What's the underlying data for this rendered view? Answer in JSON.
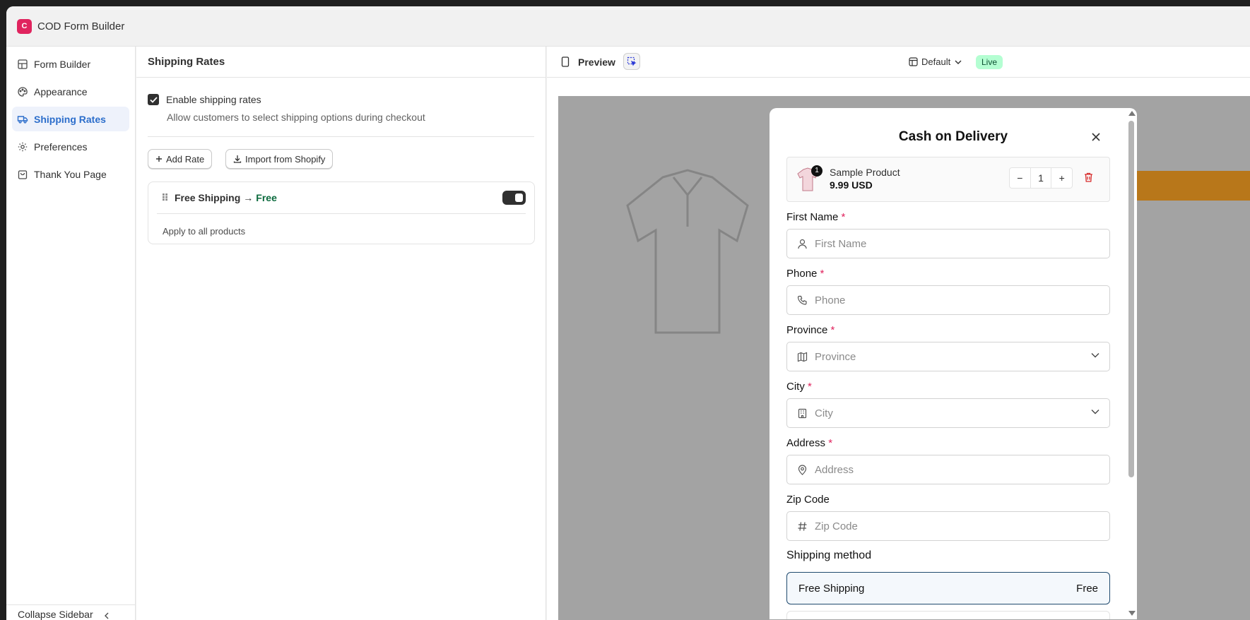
{
  "app": {
    "title": "COD Form Builder",
    "logo_text": "C"
  },
  "sidebar": {
    "items": [
      {
        "label": "Form Builder",
        "icon": "layout-icon"
      },
      {
        "label": "Appearance",
        "icon": "palette-icon"
      },
      {
        "label": "Shipping Rates",
        "icon": "truck-icon",
        "active": true
      },
      {
        "label": "Preferences",
        "icon": "gear-icon"
      },
      {
        "label": "Thank You Page",
        "icon": "bag-icon"
      }
    ],
    "collapse_label": "Collapse Sidebar"
  },
  "panel": {
    "title": "Shipping Rates",
    "enable_label": "Enable shipping rates",
    "enable_checked": true,
    "enable_help": "Allow customers to select shipping options during checkout",
    "add_rate": "Add Rate",
    "import_shopify": "Import from Shopify",
    "rate": {
      "name": "Free Shipping",
      "arrow": "→",
      "price": "Free",
      "scope": "Apply to all products",
      "enabled": true
    }
  },
  "preview": {
    "label": "Preview",
    "theme": "Default",
    "status": "Live"
  },
  "modal": {
    "title": "Cash on Delivery",
    "product": {
      "name": "Sample Product",
      "price": "9.99 USD",
      "badge": "1",
      "qty": "1"
    },
    "fields": [
      {
        "label": "First Name",
        "placeholder": "First Name",
        "required": "*"
      },
      {
        "label": "Phone",
        "placeholder": "Phone",
        "required": "*"
      },
      {
        "label": "Province",
        "placeholder": "Province",
        "required": "*"
      },
      {
        "label": "City",
        "placeholder": "City",
        "required": "*"
      },
      {
        "label": "Address",
        "placeholder": "Address",
        "required": "*"
      },
      {
        "label": "Zip Code",
        "placeholder": "Zip Code",
        "required": ""
      }
    ],
    "shipping_title": "Shipping method",
    "shipping_option": {
      "name": "Free Shipping",
      "price": "Free"
    }
  },
  "colors": {
    "accent": "#2c6ecb",
    "live_bg": "#b4fed2",
    "required": "#e0245e",
    "free": "#0b6a3d"
  }
}
